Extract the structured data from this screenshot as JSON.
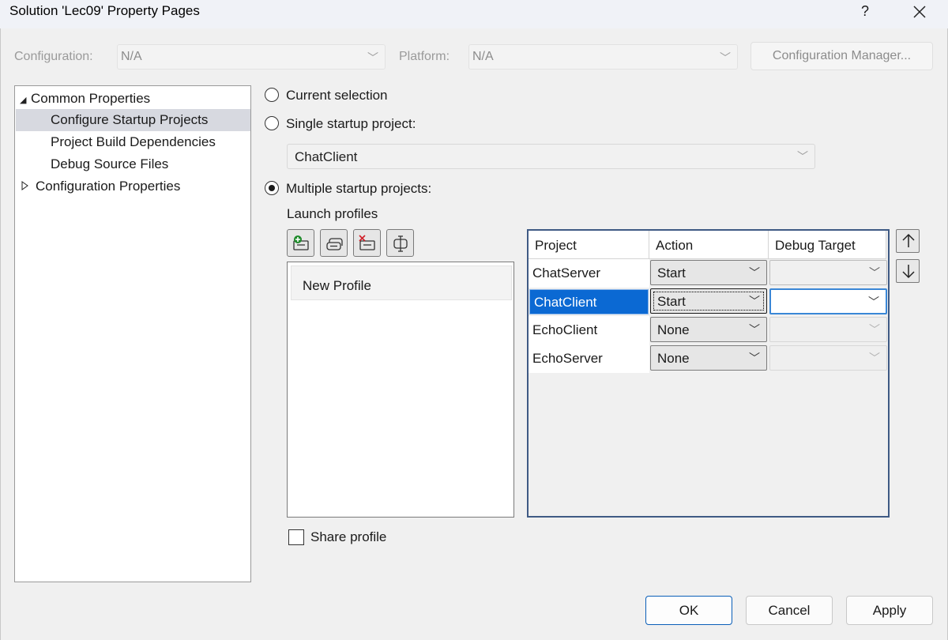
{
  "window": {
    "title": "Solution 'Lec09' Property Pages",
    "help": "?",
    "close": "✕"
  },
  "config": {
    "configuration_label": "Configuration:",
    "configuration_value": "N/A",
    "platform_label": "Platform:",
    "platform_value": "N/A",
    "manager_button": "Configuration Manager..."
  },
  "tree": {
    "items": [
      {
        "label": "Common Properties",
        "expanded": true
      },
      {
        "label": "Configure Startup Projects",
        "selected": true
      },
      {
        "label": "Project Build Dependencies"
      },
      {
        "label": "Debug Source Files"
      },
      {
        "label": "Configuration Properties",
        "expanded": false
      }
    ]
  },
  "startup": {
    "current_selection": "Current selection",
    "single_project": "Single startup project:",
    "single_project_value": "ChatClient",
    "multiple_projects": "Multiple startup projects:",
    "selected_mode": "multiple"
  },
  "launch_profiles": {
    "label": "Launch profiles",
    "tools": [
      "add-profile-icon",
      "copy-profile-icon",
      "delete-profile-icon",
      "rename-profile-icon"
    ],
    "profiles": [
      "New Profile"
    ],
    "share_label": "Share profile",
    "share_checked": false
  },
  "grid": {
    "columns": [
      "Project",
      "Action",
      "Debug Target"
    ],
    "rows": [
      {
        "project": "ChatServer",
        "action": "Start",
        "debug_target": ""
      },
      {
        "project": "ChatClient",
        "action": "Start",
        "debug_target": "",
        "selected": true
      },
      {
        "project": "EchoClient",
        "action": "None",
        "debug_target": ""
      },
      {
        "project": "EchoServer",
        "action": "None",
        "debug_target": ""
      }
    ]
  },
  "buttons": {
    "ok": "OK",
    "cancel": "Cancel",
    "apply": "Apply"
  }
}
